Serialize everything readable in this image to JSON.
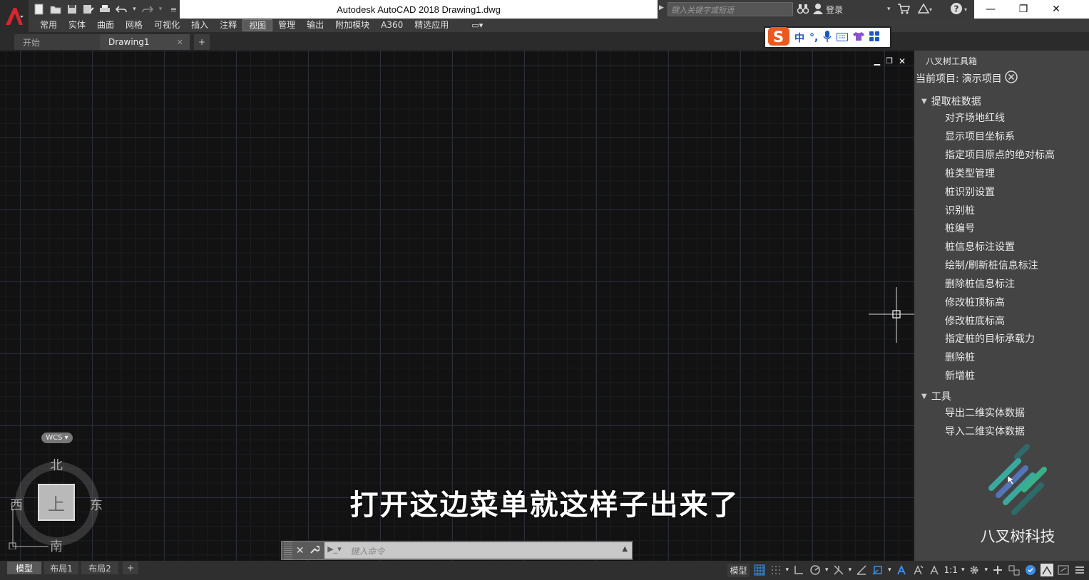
{
  "window": {
    "title": "Autodesk AutoCAD 2018    Drawing1.dwg",
    "search_placeholder": "键入关键字或短语",
    "login_label": "登录"
  },
  "menu": [
    "常用",
    "实体",
    "曲面",
    "网格",
    "可视化",
    "插入",
    "注释",
    "视图",
    "管理",
    "输出",
    "附加模块",
    "A360",
    "精选应用"
  ],
  "menu_active_index": 7,
  "tabs": {
    "start": "开始",
    "drawing": "Drawing1"
  },
  "ime": {
    "mode": "中"
  },
  "viewcube": {
    "wcs": "WCS",
    "north": "北",
    "south": "南",
    "east": "东",
    "west": "西",
    "top": "上"
  },
  "subtitle": "打开这边菜单就这样子出来了",
  "command": {
    "placeholder": "键入命令"
  },
  "palette": {
    "title": "八叉树工具箱",
    "project_label": "当前项目:",
    "project_name": "演示项目",
    "groups": [
      {
        "name": "提取桩数据",
        "items": [
          "对齐场地红线",
          "显示项目坐标系",
          "指定项目原点的绝对标高",
          "桩类型管理",
          "桩识别设置",
          "识别桩",
          "桩编号",
          "桩信息标注设置",
          "绘制/刷新桩信息标注",
          "删除桩信息标注",
          "修改桩顶标高",
          "修改桩底标高",
          "指定桩的目标承载力",
          "删除桩",
          "新增桩"
        ]
      },
      {
        "name": "工具",
        "items": [
          "导出二维实体数据",
          "导入二维实体数据"
        ]
      }
    ],
    "company": "八叉树科技",
    "logo_color": "#3a7a7a"
  },
  "layouts": {
    "model": "模型",
    "layout1": "布局1",
    "layout2": "布局2"
  },
  "status": {
    "model_label": "模型",
    "scale": "1:1"
  },
  "colors": {
    "accent_blue": "#3a8ee6",
    "app_red": "#d8262c"
  }
}
